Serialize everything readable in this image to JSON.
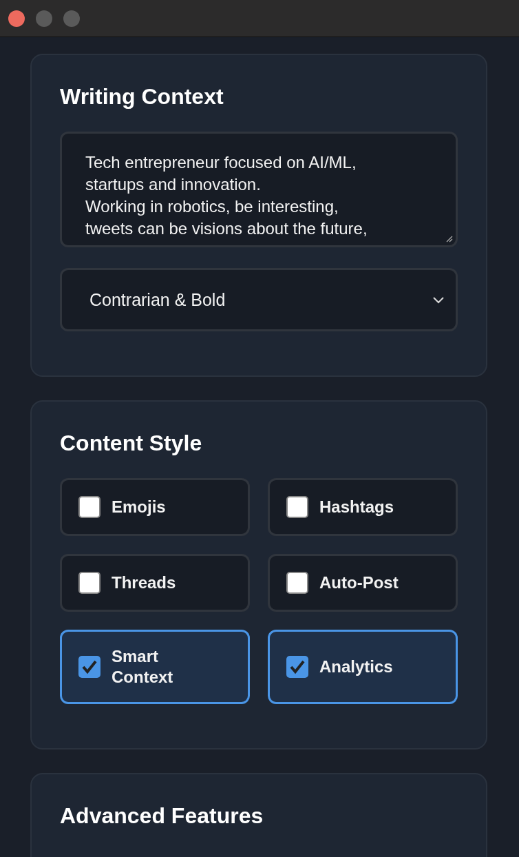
{
  "window": {
    "controls": [
      {
        "kind": "close"
      },
      {
        "kind": "minimize"
      },
      {
        "kind": "zoom"
      }
    ]
  },
  "writing_context": {
    "title": "Writing Context",
    "description": "Tech entrepreneur focused on AI/ML,\nstartups and innovation.\nWorking in robotics, be interesting,\ntweets can be visions about the future,",
    "tone": "Contrarian & Bold"
  },
  "content_style": {
    "title": "Content Style",
    "options": [
      {
        "label": "Emojis",
        "checked": false
      },
      {
        "label": "Hashtags",
        "checked": false
      },
      {
        "label": "Threads",
        "checked": false
      },
      {
        "label": "Auto-Post",
        "checked": false
      },
      {
        "label": "Smart\nContext",
        "checked": true
      },
      {
        "label": "Analytics",
        "checked": true
      }
    ]
  },
  "advanced_features": {
    "title": "Advanced Features"
  }
}
